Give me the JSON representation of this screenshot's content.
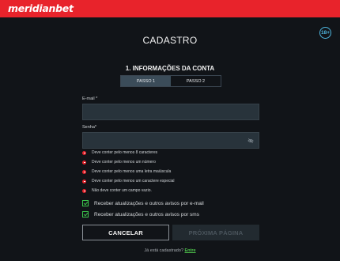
{
  "header": {
    "logo": "meridianbet"
  },
  "page": {
    "title": "CADASTRO",
    "age_badge": "18+",
    "section_title": "1. INFORMAÇÕES DA CONTA"
  },
  "steps": [
    {
      "label": "PASSO 1",
      "active": true
    },
    {
      "label": "PASSO 2",
      "active": false
    }
  ],
  "form": {
    "email_label": "E-mail *",
    "email_value": "",
    "password_label": "Senha*",
    "password_value": ""
  },
  "password_requirements": [
    "Deve conter pelo menos 8 caracteres",
    "Deve conter pelo menos um número",
    "Deve conter pelo menos uma letra maiúscula",
    "Deve conter pelo menos um caractere especial",
    "Não deve conter um campo vazio."
  ],
  "checkboxes": [
    {
      "label": "Receber atualizações e outros avisos por e-mail",
      "checked": true
    },
    {
      "label": "Receber atualizações e outros avisos por sms",
      "checked": true
    }
  ],
  "buttons": {
    "cancel": "CANCELAR",
    "next": "PRÓXIMA PÁGINA"
  },
  "footer": {
    "already_registered": "Já está cadastrado?",
    "login_link": "Entre"
  },
  "colors": {
    "brand": "#e8232b",
    "background": "#111418",
    "input": "#28333b",
    "accent_green": "#3ac24a"
  }
}
